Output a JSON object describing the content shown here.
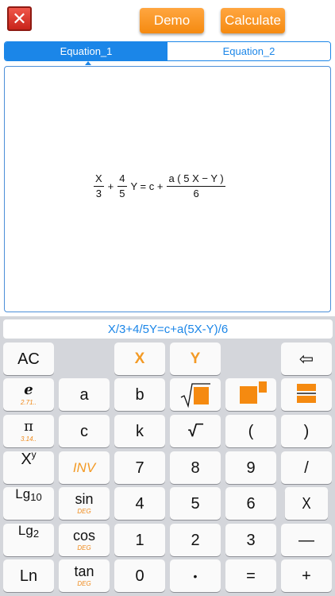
{
  "toolbar": {
    "close_glyph": "✕",
    "demo_label": "Demo",
    "calculate_label": "Calculate"
  },
  "tabs": [
    {
      "label": "Equation_1",
      "active": true
    },
    {
      "label": "Equation_2",
      "active": false
    }
  ],
  "formula": {
    "frac1_num": "X",
    "frac1_den": "3",
    "plus1": "+",
    "frac2_num": "4",
    "frac2_den": "5",
    "y_eq": "Y = c +",
    "frac3_num": "a ( 5 X − Y )",
    "frac3_den": "6"
  },
  "expression": "X/3+4/5Y=c+a(5X-Y)/6",
  "keys": {
    "ac": "AC",
    "x": "X",
    "y": "Y",
    "backspace": "⇦",
    "e": "e",
    "e_sub": "2.71..",
    "a": "a",
    "b": "b",
    "pi": "π",
    "pi_sub": "3.14..",
    "c": "c",
    "k": "k",
    "sqrt": "√‾",
    "lparen": "(",
    "rparen": ")",
    "pow_base": "X",
    "pow_exp": "y",
    "inv": "INV",
    "seven": "7",
    "eight": "8",
    "nine": "9",
    "divide": "/",
    "lg10_main": "Lg",
    "lg10_sub": "10",
    "sin": "sin",
    "sin_sub": "DEG",
    "four": "4",
    "five": "5",
    "six": "6",
    "multiply": "X",
    "lg2_main": "Lg",
    "lg2_sub": "2",
    "cos": "cos",
    "cos_sub": "DEG",
    "one": "1",
    "two": "2",
    "three": "3",
    "minus": "—",
    "ln": "Ln",
    "tan": "tan",
    "tan_sub": "DEG",
    "zero": "0",
    "dot": "•",
    "equals": "=",
    "plus": "+"
  },
  "colors": {
    "accent": "#1b86e8",
    "orange": "#f58a10"
  }
}
